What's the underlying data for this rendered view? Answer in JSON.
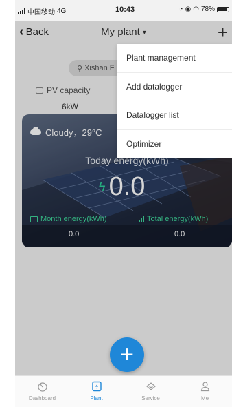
{
  "status_bar": {
    "carrier": "中国移动",
    "network": "4G",
    "time": "10:43",
    "battery": "78%"
  },
  "nav": {
    "back_label": "Back",
    "title": "My plant",
    "plus_label": "+"
  },
  "plant": {
    "location": "Xishan F",
    "pv_capacity_label": "PV capacity",
    "pv_capacity_value": "6kW"
  },
  "card": {
    "weather": "Cloudy，29°C",
    "today_label": "Today energy(kWh)",
    "today_value": "0.0",
    "month_label": "Month energy(kWh)",
    "month_value": "0.0",
    "total_label": "Total energy(kWh)",
    "total_value": "0.0"
  },
  "menu": {
    "items": [
      {
        "label": "Plant management"
      },
      {
        "label": "Add datalogger"
      },
      {
        "label": "Datalogger list"
      },
      {
        "label": "Optimizer"
      }
    ]
  },
  "fab": {
    "label": "+"
  },
  "tabs": [
    {
      "label": "Dashboard",
      "icon": "dashboard-icon",
      "active": false
    },
    {
      "label": "Plant",
      "icon": "plant-icon",
      "active": true
    },
    {
      "label": "Service",
      "icon": "service-icon",
      "active": false
    },
    {
      "label": "Me",
      "icon": "me-icon",
      "active": false
    }
  ],
  "colors": {
    "accent": "#1f87d8",
    "energy_green": "#3fd69a"
  }
}
